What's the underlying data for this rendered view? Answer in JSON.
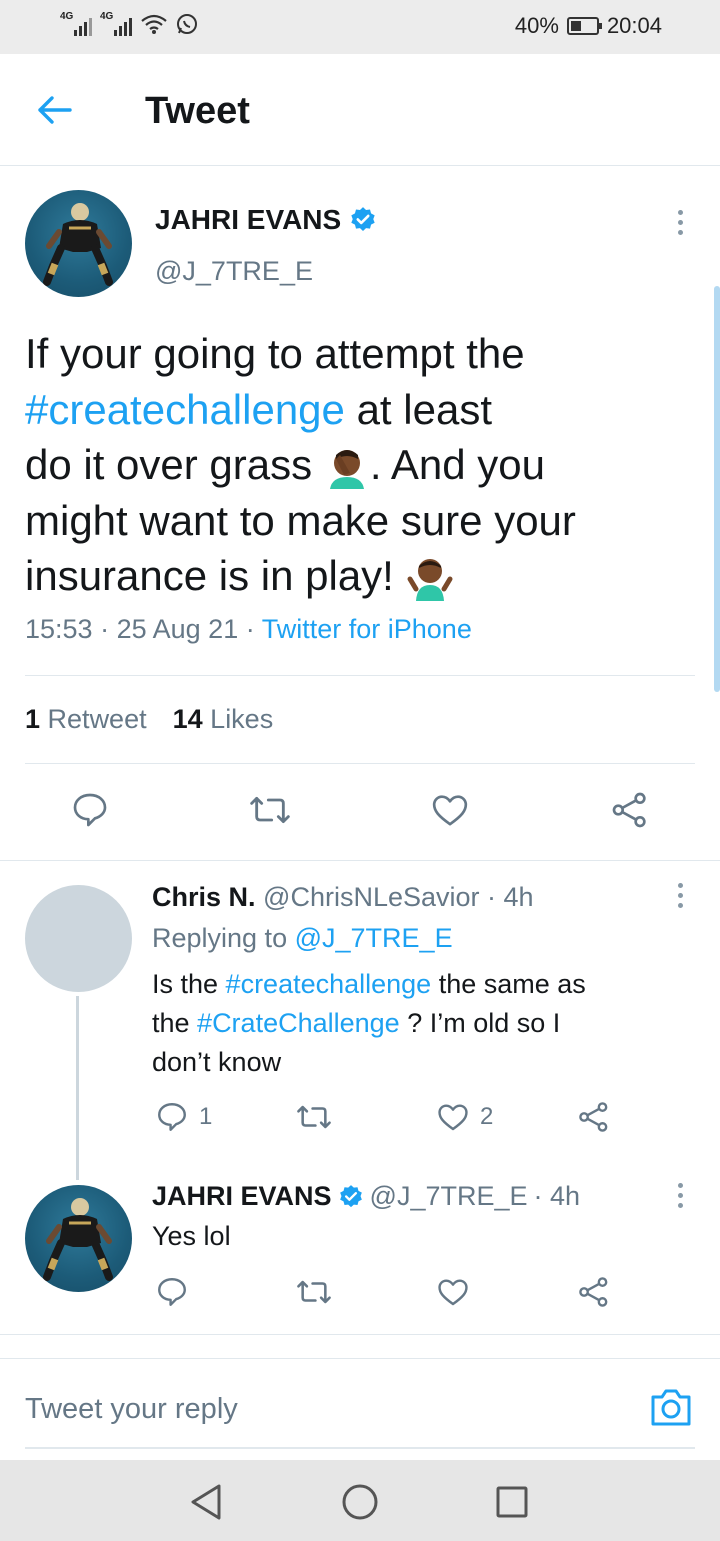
{
  "status_bar": {
    "network_1": "4G",
    "network_2": "4G",
    "battery": "40%",
    "battery_level": 0.4,
    "time": "20:04"
  },
  "header": {
    "title": "Tweet"
  },
  "tweet": {
    "author_name": "JAHRI EVANS",
    "handle": "@J_7TRE_E",
    "text_line1": "If your going to attempt the",
    "hashtag": "#createchallenge",
    "text_line2_rest": " at least",
    "text_line3": "do it over grass ",
    "text_line3_rest": ". And you",
    "text_line4": "might want to make sure your",
    "text_line5": "insurance is in play! ",
    "time": "15:53",
    "date": "25 Aug 21",
    "source": "Twitter for iPhone",
    "retweet_count": "1",
    "retweet_label": "Retweet",
    "like_count": "14",
    "like_label": "Likes"
  },
  "replies": [
    {
      "name": "Chris N.",
      "handle": "@ChrisNLeSavior",
      "age": "· 4h",
      "replying_prefix": "Replying to",
      "replying_to": "@J_7TRE_E",
      "text_part1": "Is the ",
      "hashtag1": "#createchallenge",
      "text_part2": " the same as",
      "text_part3": "the ",
      "hashtag2": "#CrateChallenge",
      "text_part4": " ? I’m old so I",
      "text_part5": "don’t know",
      "reply_count": "1",
      "like_count": "2"
    },
    {
      "name": "JAHRI EVANS",
      "handle": "@J_7TRE_E",
      "age": "· 4h",
      "text": "Yes lol"
    }
  ],
  "compose": {
    "placeholder": "Tweet your reply"
  },
  "colors": {
    "accent": "#1da1f2",
    "muted": "#657786",
    "text": "#14171a",
    "divider": "#e1e8ed"
  }
}
